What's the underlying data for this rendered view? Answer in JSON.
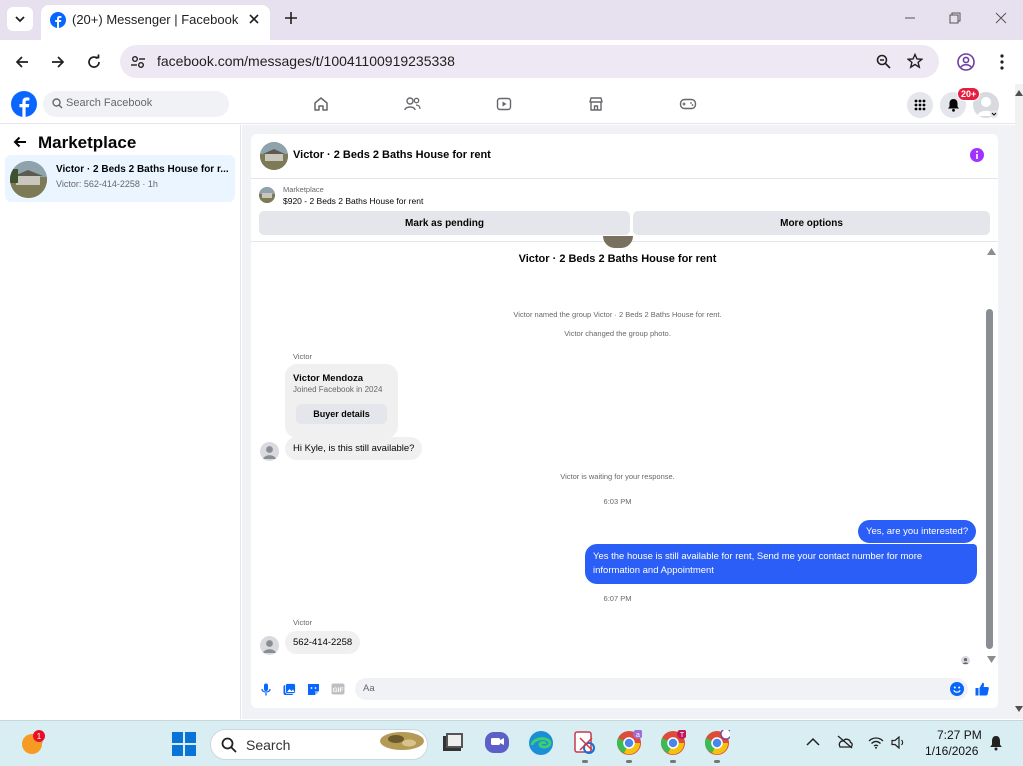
{
  "browser": {
    "tab_title": "(20+) Messenger | Facebook",
    "url_host": "facebook.com",
    "url_path": "/messages/t/10041100919235338"
  },
  "fb_header": {
    "search_placeholder": "Search Facebook",
    "notification_count": "20+",
    "nav_icons": [
      "home-icon",
      "friends-icon",
      "video-icon",
      "marketplace-icon",
      "gaming-icon"
    ]
  },
  "left_pane": {
    "title": "Marketplace",
    "conversation": {
      "title": "Victor · 2 Beds 2 Baths House for r...",
      "subtitle": "Victor: 562-414-2258 · 1h"
    }
  },
  "chat": {
    "header_title": "Victor · 2 Beds 2 Baths House for rent",
    "marketplace_label": "Marketplace",
    "listing": "$920 - 2 Beds 2 Baths House for rent",
    "mark_pending_label": "Mark as pending",
    "more_options_label": "More options",
    "group_name": "Victor · 2 Beds 2 Baths House for rent",
    "note_named": "Victor named the group Victor · 2 Beds 2 Baths House for rent.",
    "note_photo": "Victor changed the group photo.",
    "sender_1": "Victor",
    "buyer_name": "Victor Mendoza",
    "buyer_joined": "Joined Facebook in 2024",
    "buyer_details_label": "Buyer details",
    "msg_in_1": "Hi Kyle, is this still available?",
    "note_waiting": "Victor is waiting for your response.",
    "time_1": "6:03 PM",
    "msg_out_1": "Yes, are you interested?",
    "msg_out_2": "Yes the house is still available for rent, Send me your contact number for more information and Appointment",
    "time_2": "6:07 PM",
    "sender_2": "Victor",
    "msg_in_2": "562-414-2258",
    "composer_placeholder": "Aa"
  },
  "taskbar": {
    "search_label": "Search",
    "time": "7:27 PM",
    "date": "1/16/2026"
  },
  "colors": {
    "fb_blue": "#0866ff",
    "outgoing_bubble": "#2b5ef6",
    "selected_item": "#ebf5ff",
    "badge_red": "#e41e3f",
    "info_purple": "#a033ff"
  }
}
